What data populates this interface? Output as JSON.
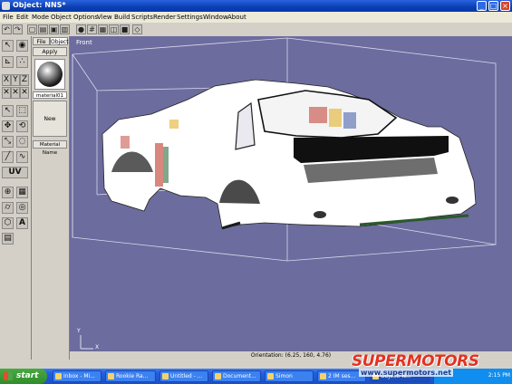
{
  "window": {
    "title": "Object: NNS*"
  },
  "menu": [
    "File",
    "Edit",
    "Mode",
    "Object",
    "Options",
    "View",
    "Build",
    "Scripts",
    "Render",
    "Settings",
    "Window",
    "About"
  ],
  "panel": {
    "tabs": [
      "File",
      "Object"
    ],
    "apply_label": "Apply",
    "material_label": "material01",
    "new_label": "New",
    "material_name_label": "Material Name"
  },
  "viewport": {
    "view_name": "Front",
    "orientation": "Orientation: (6.25, 160, 4.76)",
    "axis_y": "Y",
    "axis_x": "X",
    "bg_color": "#6c6c9e"
  },
  "taskbar": {
    "start_label": "start",
    "tasks": [
      "Inbox - Mi...",
      "Rookie Ra...",
      "Untitled - ...",
      "Document...",
      "Simon",
      "2 IM ses...",
      "Object: N..."
    ],
    "clock": "2:15 PM"
  },
  "watermark": {
    "brand": "SUPERMOTORS",
    "url": "www.supermotors.net"
  }
}
